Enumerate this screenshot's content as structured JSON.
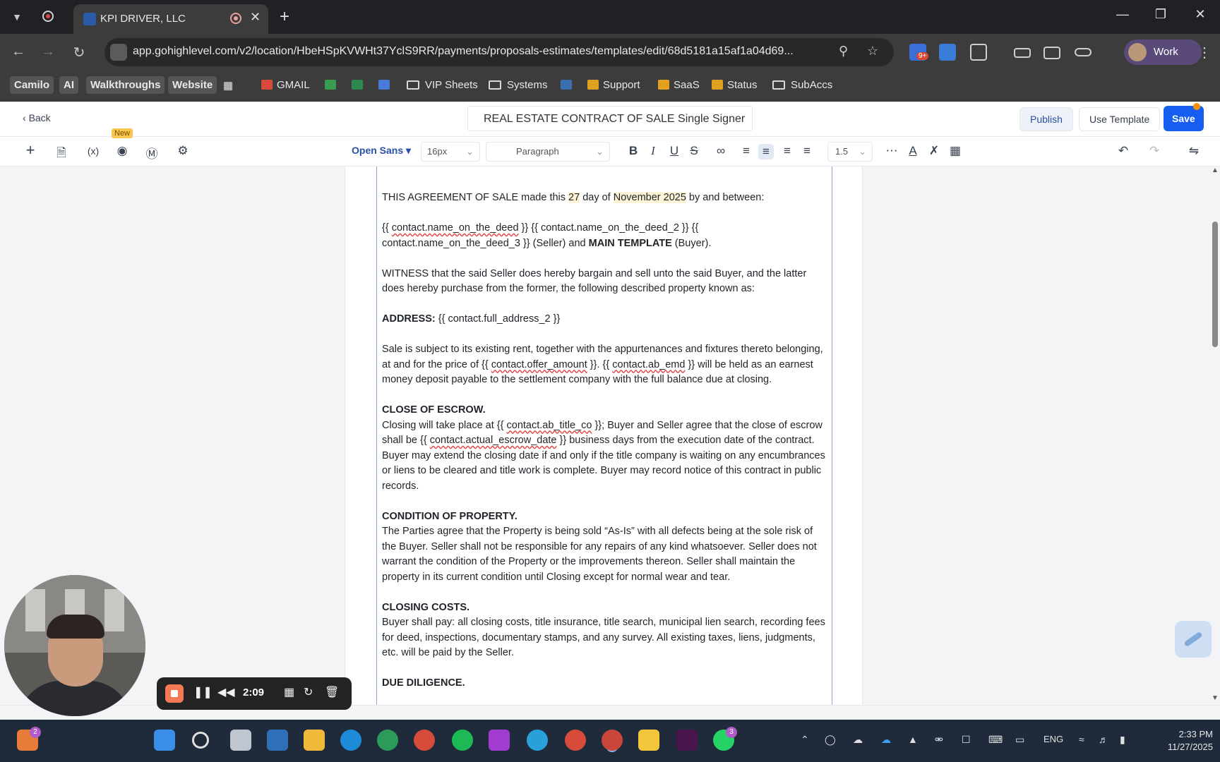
{
  "browser": {
    "tab_title": "KPI DRIVER, LLC",
    "url": "app.gohighlevel.com/v2/location/HbeHSpKVWHt37YclS9RR/payments/proposals-estimates/templates/edit/68d5181a15af1a04d69...",
    "profile_label": "Work",
    "extension_badge": "9+"
  },
  "bookmarks": [
    {
      "label": "Camilo"
    },
    {
      "label": "AI"
    },
    {
      "label": "Walkthroughs"
    },
    {
      "label": "Website"
    },
    {
      "label": "GMAIL"
    },
    {
      "label": "VIP Sheets"
    },
    {
      "label": "Systems"
    },
    {
      "label": "Support"
    },
    {
      "label": "SaaS"
    },
    {
      "label": "Status"
    },
    {
      "label": "SubAccs"
    }
  ],
  "header": {
    "back_label": "Back",
    "document_title": "REAL ESTATE CONTRACT OF SALE Single Signer",
    "publish_label": "Publish",
    "use_template_label": "Use Template",
    "save_label": "Save"
  },
  "toolbar": {
    "new_badge": "New",
    "variables_icon_text": "(x)",
    "font_family": "Open Sans",
    "font_size": "16px",
    "block_type": "Paragraph",
    "line_height": "1.5"
  },
  "document": {
    "p1_a": "THIS AGREEMENT OF SALE made this ",
    "p1_day": "27",
    "p1_b": " day of ",
    "p1_month": "November 2025",
    "p1_c": " by and between:",
    "p2_a": "{{ ",
    "p2_var1": "contact.name_on_the_deed",
    "p2_b": " }} {{ contact.name_on_the_deed_2 }} {{ contact.name_on_the_deed_3 }} (Seller) and ",
    "p2_bold": "MAIN TEMPLATE",
    "p2_c": " (Buyer).",
    "p3": "WITNESS that the said Seller does hereby bargain and sell unto the said Buyer, and the latter does hereby purchase from the former, the following described property known as:",
    "p4_label": "ADDRESS:",
    "p4_value": " {{ contact.full_address_2 }}",
    "p5_a": "Sale is subject to its existing rent, together with the appurtenances and fixtures thereto belonging, at and for the price of {{ ",
    "p5_var1": "contact.offer_amount",
    "p5_b": " }}. {{ ",
    "p5_var2": "contact.ab_emd",
    "p5_c": " }} will be held as an earnest money deposit payable to the settlement company with the full balance due at closing.",
    "h_escrow": "CLOSE OF ESCROW.",
    "p6_a": "Closing will take place at {{ ",
    "p6_var1": "contact.ab_title_co",
    "p6_b": " }}; Buyer and Seller agree that the close of escrow shall be {{ ",
    "p6_var2": "contact.actual_escrow_date",
    "p6_c": " }} business days from the execution date of the contract. Buyer may extend the closing date if and only if the title company is waiting on any encumbrances or liens to be cleared and title work is complete. Buyer may record notice of this contract in public records.",
    "h_condition": "CONDITION OF PROPERTY.",
    "p7": "The Parties agree that the Property is being sold “As-Is” with all defects being at the sole risk of the Buyer. Seller shall not be responsible for any repairs of any kind whatsoever. Seller does not warrant the condition of the Property or the improvements thereon. Seller shall maintain the property in its current condition until Closing except for normal wear and tear.",
    "h_costs": "CLOSING COSTS.",
    "p8": "Buyer shall pay: all closing costs, title insurance, title search, municipal lien search, recording fees for deed, inspections, documentary stamps, and any survey. All existing taxes, liens, judgments, etc. will be paid by the Seller.",
    "h_diligence": "DUE DILIGENCE."
  },
  "recorder": {
    "time": "2:09"
  },
  "taskbar": {
    "badge_left": "2",
    "badge_whatsapp": "3",
    "language": "ENG",
    "time": "2:33 PM",
    "date": "11/27/2025"
  },
  "colors": {
    "accent": "#155eef",
    "save_dot": "#f79009",
    "variable_highlight": "#fdf3d7"
  }
}
